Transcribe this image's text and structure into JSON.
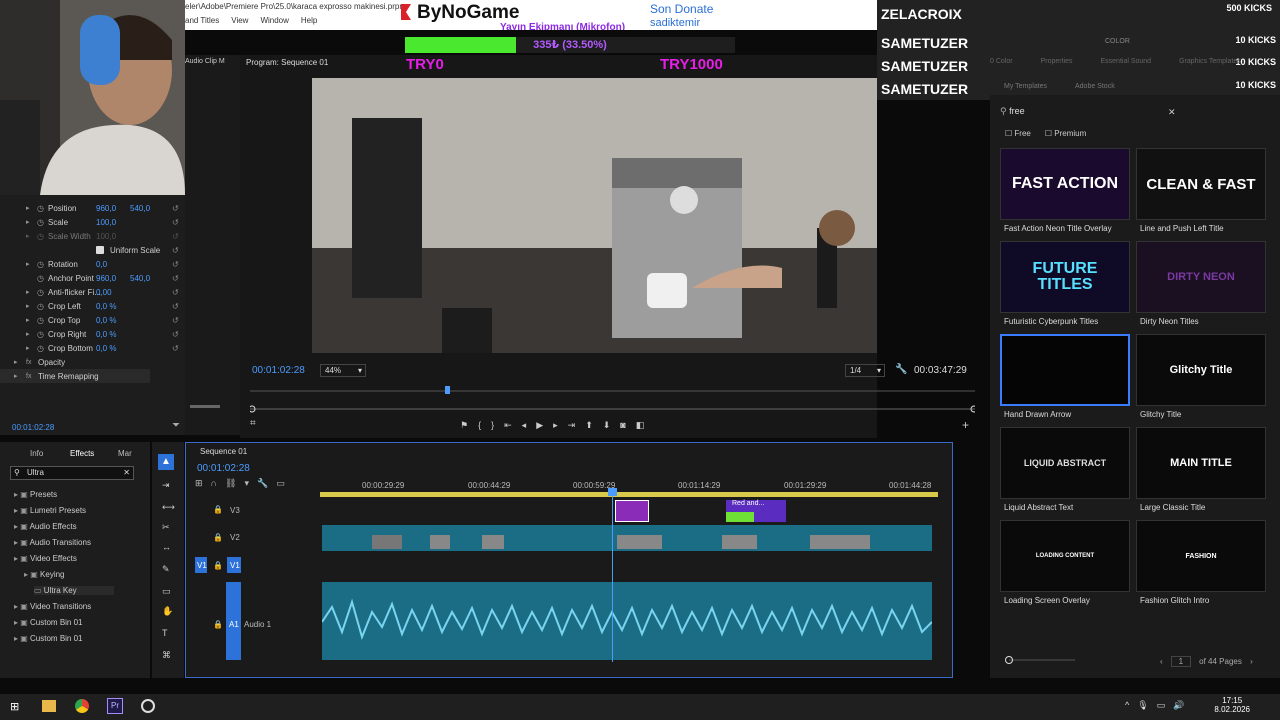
{
  "window": {
    "path": "eler\\Adobe\\Premiere Pro\\25.0\\karaca exprosso makinesi.prpr",
    "menus": [
      "and Titles",
      "View",
      "Window",
      "Help"
    ]
  },
  "overlay": {
    "brand": "ByNoGame",
    "donate_label": "Son Donate",
    "donate_name": "sadiktemir",
    "ticker": "Yayın Ekipmanı (Mikrofon)",
    "goal_text": "335₺ (33.50%)",
    "goal_progress": 0.335,
    "goal_start": "TRY0",
    "goal_end": "TRY1000"
  },
  "kicks": [
    {
      "name": "ZELACROIX",
      "count": "500 KICKS"
    },
    {
      "name": "SAMETUZER",
      "count": "10 KICKS"
    },
    {
      "name": "SAMETUZER",
      "count": "10 KICKS"
    },
    {
      "name": "SAMETUZER",
      "count": "10 KICKS"
    }
  ],
  "effect_controls": {
    "rows": [
      {
        "label": "Position",
        "v1": "960,0",
        "v2": "540,0"
      },
      {
        "label": "Scale",
        "v1": "100,0",
        "v2": ""
      },
      {
        "label": "Scale Width",
        "v1": "100,0",
        "v2": ""
      },
      {
        "label": "Uniform Scale",
        "v1": "",
        "v2": ""
      },
      {
        "label": "Rotation",
        "v1": "0,0",
        "v2": ""
      },
      {
        "label": "Anchor Point",
        "v1": "960,0",
        "v2": "540,0"
      },
      {
        "label": "Anti-flicker Fi...",
        "v1": "0,00",
        "v2": ""
      },
      {
        "label": "Crop Left",
        "v1": "0,0 %",
        "v2": ""
      },
      {
        "label": "Crop Top",
        "v1": "0,0 %",
        "v2": ""
      },
      {
        "label": "Crop Right",
        "v1": "0,0 %",
        "v2": ""
      },
      {
        "label": "Crop Bottom",
        "v1": "0,0 %",
        "v2": ""
      }
    ],
    "opacity": "Opacity",
    "time_remapping": "Time Remapping",
    "timecode": "00:01:02:28",
    "audio_clip_tab": "Audio Clip M"
  },
  "program": {
    "title": "Program: Sequence 01",
    "timecode": "00:01:02:28",
    "zoom": "44%",
    "quality": "1/4",
    "duration": "00:03:47:29"
  },
  "effects_panel": {
    "tabs": [
      "Info",
      "Effects",
      "Mar"
    ],
    "search": "Ultra",
    "items": [
      {
        "label": "Presets",
        "indent": 0
      },
      {
        "label": "Lumetri Presets",
        "indent": 0
      },
      {
        "label": "Audio Effects",
        "indent": 0
      },
      {
        "label": "Audio Transitions",
        "indent": 0
      },
      {
        "label": "Video Effects",
        "indent": 0
      },
      {
        "label": "Keying",
        "indent": 1
      },
      {
        "label": "Ultra Key",
        "indent": 2
      },
      {
        "label": "Video Transitions",
        "indent": 0
      },
      {
        "label": "Custom Bin 01",
        "indent": 0
      },
      {
        "label": "Custom Bin 01",
        "indent": 0
      }
    ]
  },
  "timeline": {
    "title": "Sequence 01",
    "timecode": "00:01:02:28",
    "ruler": [
      "00:00:29:29",
      "00:00:44:29",
      "00:00:59:29",
      "00:01:14:29",
      "00:01:29:29",
      "00:01:44:28"
    ],
    "tracks": [
      "V3",
      "V2",
      "V1",
      "A1"
    ],
    "audio_track_name": "Audio 1",
    "clip_label": "Red and..."
  },
  "essential_graphics": {
    "top_tabs": [
      "COLOR"
    ],
    "menu": [
      "0 Color",
      "Properties",
      "Essential Sound",
      "Graphics Templates"
    ],
    "sources": [
      "My Templates",
      "Adobe Stock"
    ],
    "search": "free",
    "filters": [
      "Free",
      "Premium"
    ],
    "templates": [
      {
        "name": "Fast Action Neon Title Overlay",
        "thumb": "FAST ACTION"
      },
      {
        "name": "Line and Push Left Title",
        "thumb": "CLEAN & FAST"
      },
      {
        "name": "Futuristic Cyberpunk Titles",
        "thumb": "FUTURE TITLES"
      },
      {
        "name": "Dirty Neon Titles",
        "thumb": "DIRTY NEON"
      },
      {
        "name": "Hand Drawn Arrow",
        "thumb": ""
      },
      {
        "name": "Glitchy Title",
        "thumb": "Glitchy Title"
      },
      {
        "name": "Liquid Abstract Text",
        "thumb": "LIQUID ABSTRACT"
      },
      {
        "name": "Large Classic Title",
        "thumb": "MAIN TITLE"
      },
      {
        "name": "Loading Screen Overlay",
        "thumb": "LOADING CONTENT"
      },
      {
        "name": "Fashion Glitch Intro",
        "thumb": "FASHION"
      }
    ],
    "page": "1",
    "of_pages": "of 44 Pages"
  },
  "taskbar": {
    "time": "17:15",
    "date": "8.02.2026"
  },
  "colors": {
    "accent": "#4b9cff",
    "overlay_magenta": "#e61ee6",
    "goal_green": "#4be830"
  }
}
